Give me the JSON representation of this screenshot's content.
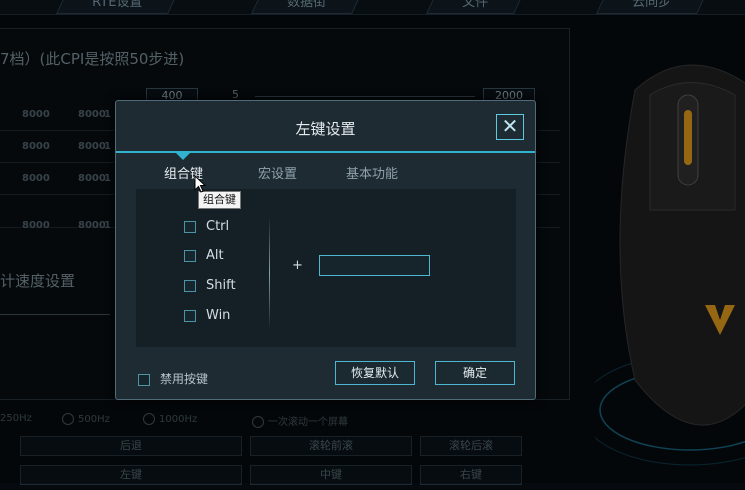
{
  "top_tabs": [
    "RTE设置",
    "数据街",
    "文件",
    "云同步"
  ],
  "cpi": {
    "title": "7档）(此CPI是按照50步进)",
    "value_left": "400",
    "value_small": "5",
    "value_right": "2000",
    "rows": [
      [
        "8000",
        "8000",
        "1"
      ],
      [
        "8000",
        "8000",
        "1"
      ],
      [
        "8000",
        "8000",
        "1"
      ],
      [
        "8000",
        "8000",
        "1"
      ]
    ]
  },
  "speed_title": "计速度设置",
  "bottom_options": {
    "rates": [
      "250Hz",
      "500Hz",
      "1000Hz"
    ],
    "scroll": "一次滚动一个屏幕",
    "row1": [
      "后退",
      "滚轮前滚",
      "滚轮后滚"
    ],
    "row2": [
      "左键",
      "中键",
      "右键"
    ]
  },
  "dialog": {
    "title": "左键设置",
    "close": "✕",
    "tabs": [
      "组合键",
      "宏设置",
      "基本功能"
    ],
    "tooltip": "组合键",
    "modifiers": [
      "Ctrl",
      "Alt",
      "Shift",
      "Win"
    ],
    "plus": "+",
    "key_value": "",
    "disable_label": "禁用按键",
    "restore_button": "恢复默认",
    "ok_button": "确定"
  },
  "colors": {
    "accent": "#31b3d0",
    "dialog_bg": "#1e2b33",
    "mouse_accent": "#c98a1a"
  }
}
